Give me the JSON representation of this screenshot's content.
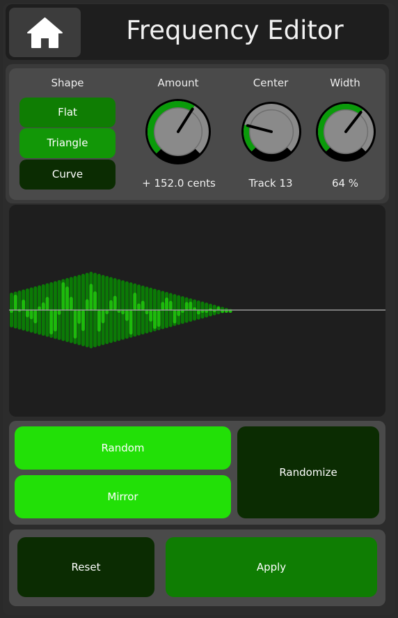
{
  "header": {
    "title": "Frequency Editor",
    "home_icon": "home-icon"
  },
  "controls": {
    "shape_label": "Shape",
    "shapes": [
      "Flat",
      "Triangle",
      "Curve"
    ],
    "selected_shape": "Triangle",
    "amount": {
      "label": "Amount",
      "value_text": "+ 152.0 cents",
      "level": 0.62
    },
    "center": {
      "label": "Center",
      "value_text": "Track 13",
      "level": 0.22
    },
    "width": {
      "label": "Width",
      "value_text": "64 %",
      "level": 0.64
    }
  },
  "actions": {
    "random_label": "Random",
    "mirror_label": "Mirror",
    "randomize_label": "Randomize"
  },
  "footer": {
    "reset_label": "Reset",
    "apply_label": "Apply"
  },
  "colors": {
    "accent_bright": "#22e007",
    "accent_mid": "#0f7d03",
    "accent_dark": "#0b2c02",
    "knob_fill": "#0a9b0a",
    "background": "#2a2a2a"
  }
}
